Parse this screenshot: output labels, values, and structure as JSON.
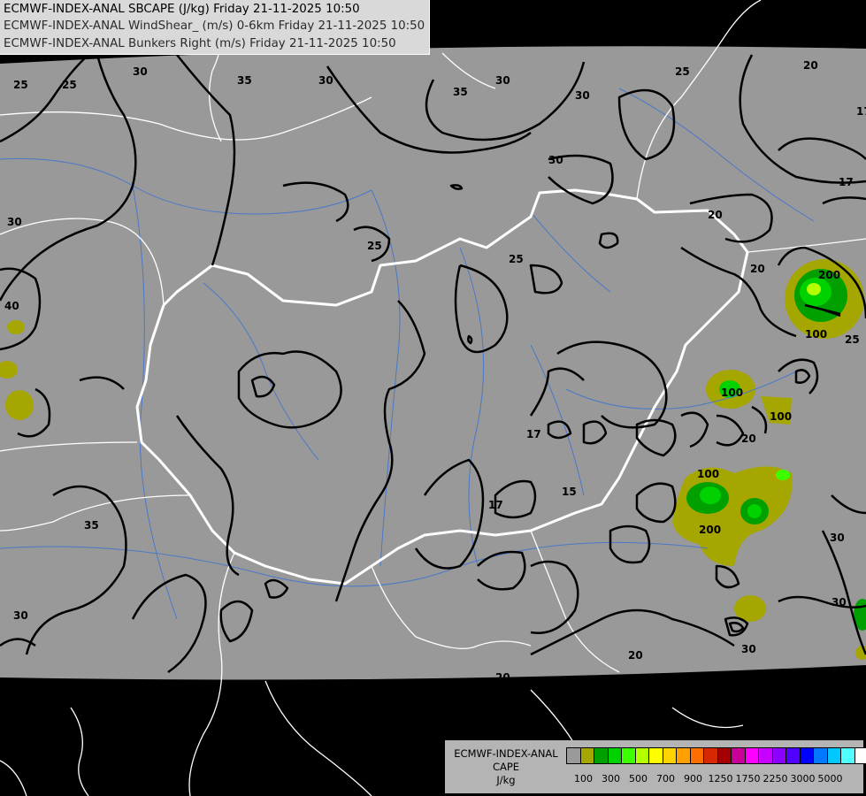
{
  "titles": [
    "ECMWF-INDEX-ANAL SBCAPE (J/kg) Friday 21-11-2025 10:50",
    "ECMWF-INDEX-ANAL WindShear_ (m/s) 0-6km Friday 21-11-2025 10:50",
    "ECMWF-INDEX-ANAL Bunkers Right (m/s) Friday 21-11-2025 10:50"
  ],
  "legend": {
    "title_line1": "ECMWF-INDEX-ANAL",
    "title_line2": "CAPE",
    "unit": "J/kg",
    "colors": [
      "#9a9a9a",
      "#a6a600",
      "#00a000",
      "#00d200",
      "#3cff00",
      "#b4ff00",
      "#ffff00",
      "#ffd200",
      "#ffa000",
      "#ff6e00",
      "#d72800",
      "#a50000",
      "#c80096",
      "#ff00ff",
      "#c800ff",
      "#8c00ff",
      "#5000ff",
      "#0000ff",
      "#0078ff",
      "#00c8ff",
      "#50ffff",
      "#ffffff"
    ],
    "ticks": [
      "100",
      "300",
      "500",
      "700",
      "900",
      "1250",
      "1750",
      "2250",
      "3000",
      "5000"
    ]
  },
  "contour_labels": [
    "25",
    "30",
    "35",
    "30",
    "30",
    "35",
    "25",
    "20",
    "17",
    "30",
    "17",
    "30",
    "20",
    "25",
    "20",
    "40",
    "25",
    "25",
    "30",
    "25",
    "17",
    "17",
    "15",
    "100",
    "20",
    "100",
    "100",
    "200",
    "30",
    "30",
    "20",
    "30",
    "35",
    "30",
    "20",
    "100",
    "200"
  ],
  "colors": {
    "land_analysis": "#999999",
    "outside": "#000000",
    "contour": "#000000",
    "borders": "#ffffff",
    "rivers": "#4a78c8"
  }
}
